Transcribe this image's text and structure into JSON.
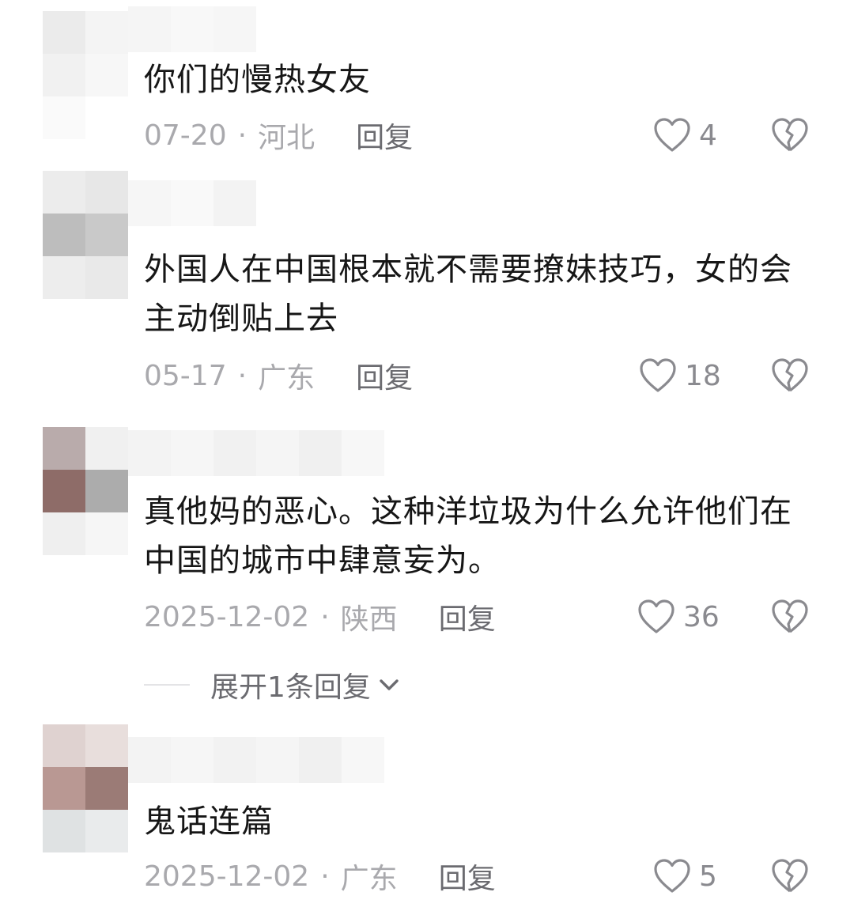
{
  "comments": [
    {
      "text": "你们的慢热女友",
      "date": "07-20",
      "location": "河北",
      "reply_label": "回复",
      "like_count": "4",
      "like_icon": "heart-outline-icon",
      "dislike_icon": "broken-heart-icon"
    },
    {
      "text": "外国人在中国根本就不需要撩妹技巧，女的会主动倒贴上去",
      "date": "05-17",
      "location": "广东",
      "reply_label": "回复",
      "like_count": "18",
      "like_icon": "heart-outline-icon",
      "dislike_icon": "broken-heart-icon"
    },
    {
      "text": "真他妈的恶心。这种洋垃圾为什么允许他们在中国的城市中肆意妄为。",
      "date": "2025-12-02",
      "location": "陕西",
      "reply_label": "回复",
      "like_count": "36",
      "like_icon": "heart-outline-icon",
      "dislike_icon": "broken-heart-icon",
      "expand_label": "展开1条回复"
    },
    {
      "text": "鬼话连篇",
      "date": "2025-12-02",
      "location": "广东",
      "reply_label": "回复",
      "like_count": "5",
      "like_icon": "heart-outline-icon",
      "dislike_icon": "broken-heart-icon"
    }
  ],
  "colors": {
    "text": "#161616",
    "meta": "#a9a9ad",
    "action": "#6b6b70",
    "icon": "#8a8a8f"
  }
}
